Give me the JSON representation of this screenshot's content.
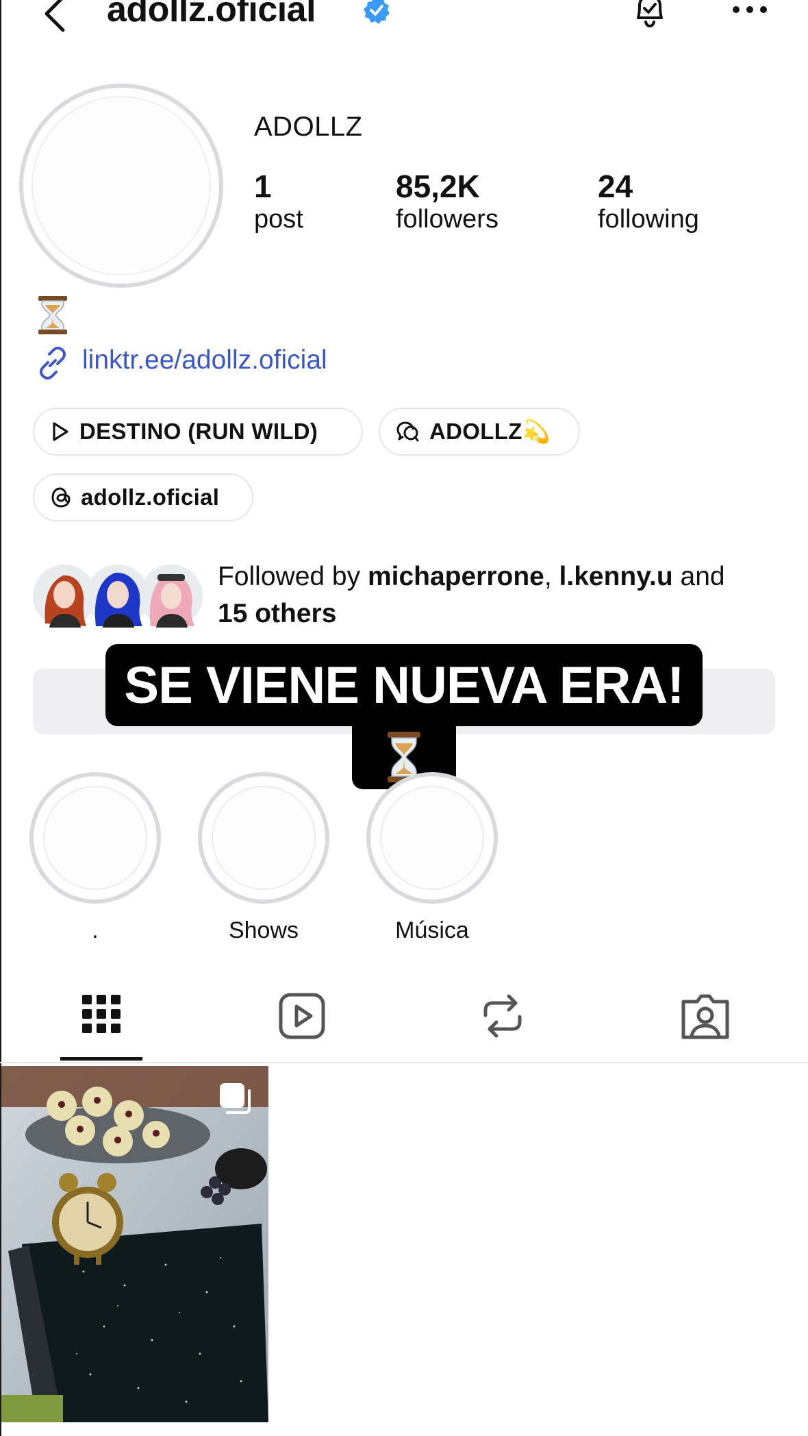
{
  "header": {
    "username": "adollz.oficial",
    "icons": {
      "back": "chevron-left-icon",
      "verified": "verified-badge-icon",
      "notifications": "bell-check-icon",
      "more": "more-horizontal-icon"
    }
  },
  "profile": {
    "display_name": "ADOLLZ",
    "stats": [
      {
        "value": "1",
        "label": "post"
      },
      {
        "value": "85,2K",
        "label": "followers"
      },
      {
        "value": "24",
        "label": "following"
      }
    ],
    "bio_emoji": "hourglass",
    "link": "linktr.ee/adollz.oficial"
  },
  "pills": [
    {
      "icon": "play-icon",
      "label": "DESTINO (RUN WILD)"
    },
    {
      "icon": "chat-icon",
      "label": "ADOLLZ💫"
    },
    {
      "icon": "threads-icon",
      "label": "adollz.oficial"
    }
  ],
  "followed_by": {
    "prefix": "Followed by ",
    "user1": "michaperrone",
    "separator": ", ",
    "user2": "l.kenny.u",
    "conjunction": " and",
    "others": "15 others"
  },
  "overlay": {
    "caption": "SE VIENE NUEVA ERA!",
    "emoji": "hourglass"
  },
  "highlights": [
    {
      "label": "."
    },
    {
      "label": "Shows"
    },
    {
      "label": "Música"
    }
  ],
  "tabs": [
    {
      "icon": "grid-icon",
      "active": true
    },
    {
      "icon": "reels-icon",
      "active": false
    },
    {
      "icon": "reposts-icon",
      "active": false
    },
    {
      "icon": "tagged-icon",
      "active": false
    }
  ],
  "posts": [
    {
      "type": "carousel"
    }
  ],
  "colors": {
    "link": "#3a57c9",
    "verified": "#3b9af5",
    "action_bar": "#efeff1",
    "ring": "#d9dadd"
  }
}
